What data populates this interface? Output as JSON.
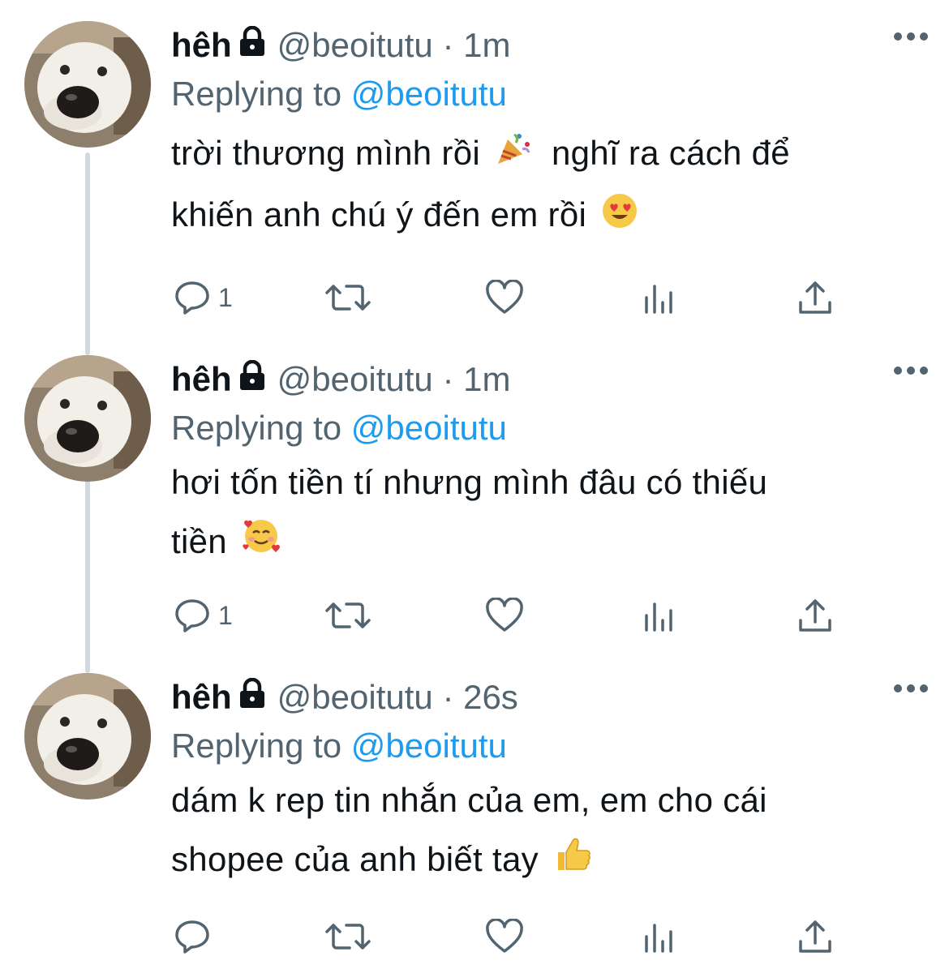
{
  "tweets": [
    {
      "name": "hêh",
      "handle": "@beoitutu · 1m",
      "replying_prefix": "Replying to",
      "replying_to": "@beoitutu",
      "line1": "trời thương mình rồi",
      "line1b": "nghĩ ra cách để",
      "line2": "khiến anh chú ý đến em rồi",
      "reply_count": "1",
      "emoji1": "party-popper-icon",
      "emoji2": "heart-eyes-icon"
    },
    {
      "name": "hêh",
      "handle": "@beoitutu · 1m",
      "replying_prefix": "Replying to",
      "replying_to": "@beoitutu",
      "line1": "hơi tốn tiền tí nhưng mình đâu có thiếu",
      "line2": "tiền",
      "reply_count": "1",
      "emoji2": "smiling-face-with-hearts-icon"
    },
    {
      "name": "hêh",
      "handle": "@beoitutu · 26s",
      "replying_prefix": "Replying to",
      "replying_to": "@beoitutu",
      "line1": "dám k rep tin nhắn của em, em cho cái",
      "line2": "shopee của anh biết tay",
      "reply_count": "",
      "emoji2": "thumbs-up-icon"
    }
  ],
  "colors": {
    "text": "#0f1419",
    "secondary": "#536471",
    "link": "#1d9bf0",
    "thread_line": "#cfd9de"
  }
}
